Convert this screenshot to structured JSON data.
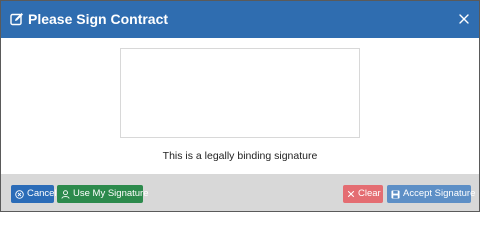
{
  "dialog": {
    "title": "Please Sign Contract",
    "header_color": "#2f6db0",
    "signature_note": "This is a legally binding signature"
  },
  "footer": {
    "cancel_label": "Cancel",
    "use_signature_label": "Use My Signature",
    "clear_label": "Clear",
    "accept_label": "Accept Signature"
  },
  "colors": {
    "cancel": "#2b6cb8",
    "use_signature": "#2c8a4c",
    "clear": "#e46d72",
    "accept": "#5d8fc6",
    "footer_bg": "#d8d8d8"
  },
  "icons": {
    "header": "edit-icon",
    "close": "close-icon",
    "cancel": "circle-x-icon",
    "use_signature": "user-icon",
    "clear": "x-icon",
    "accept": "save-icon"
  }
}
